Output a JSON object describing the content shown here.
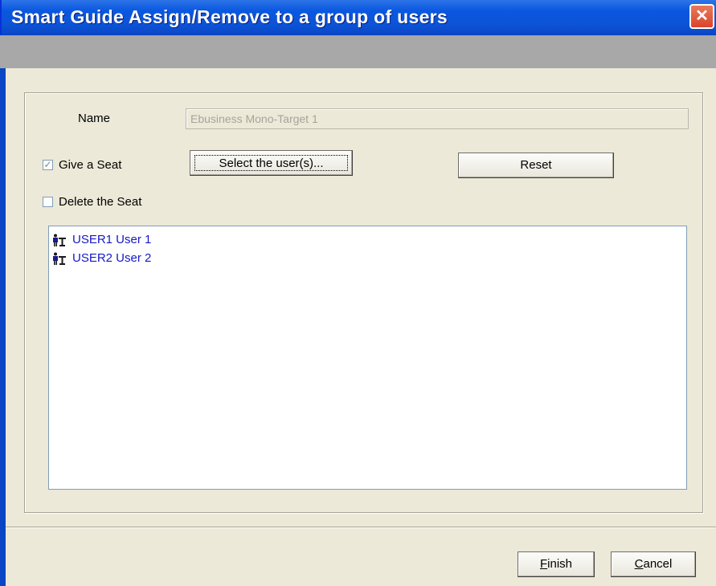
{
  "window": {
    "title": "Smart Guide Assign/Remove to a group of users",
    "close_glyph": "✕"
  },
  "form": {
    "name_label": "Name",
    "name_value": "Ebusiness Mono-Target 1",
    "give_seat": {
      "label": "Give a Seat",
      "checked": true
    },
    "delete_seat": {
      "label": "Delete the Seat",
      "checked": false
    },
    "select_users_label": "Select the user(s)...",
    "reset_label": "Reset"
  },
  "users": [
    {
      "label": "USER1 User 1",
      "icon": "users-icon"
    },
    {
      "label": "USER2 User 2",
      "icon": "users-icon"
    }
  ],
  "footer": {
    "finish_accel": "F",
    "finish_rest": "inish",
    "cancel_accel": "C",
    "cancel_rest": "ancel"
  },
  "colors": {
    "title_bar": "#0a58e0",
    "user_text": "#1717c8",
    "background": "#ece9d8"
  }
}
